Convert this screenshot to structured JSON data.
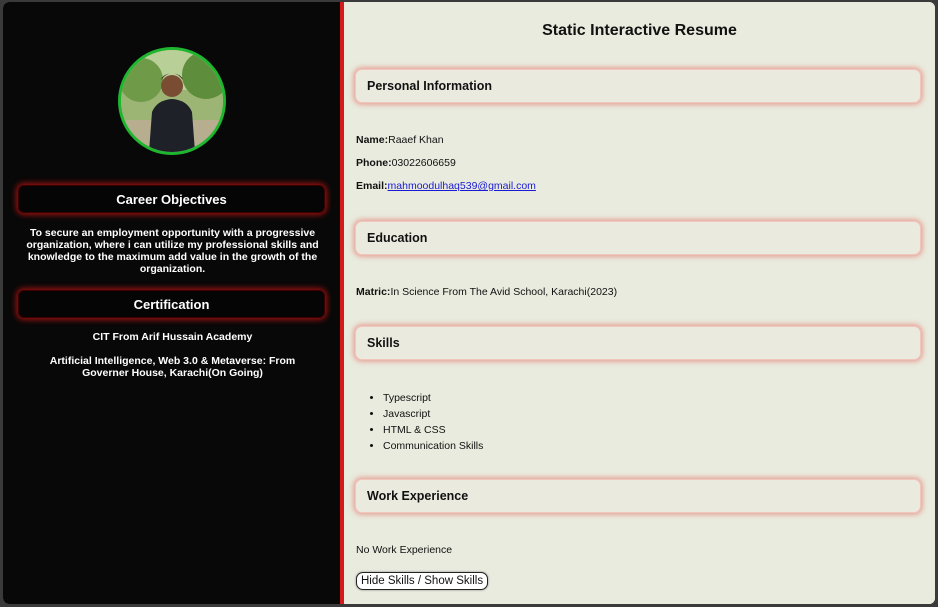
{
  "sidebar": {
    "career_heading": "Career Objectives",
    "career_text": "To secure an employment opportunity with a progressive organization, where i can utilize my professional skills and knowledge to the maximum add value in the growth of the organization.",
    "cert_heading": "Certification",
    "certs": [
      "CIT From Arif Hussain Academy",
      "Artificial Intelligence, Web 3.0 & Metaverse: From Governer House, Karachi(On Going)"
    ]
  },
  "main": {
    "title": "Static Interactive Resume",
    "personal": {
      "heading": "Personal Information",
      "name_label": "Name:",
      "name_value": "Raaef Khan",
      "phone_label": "Phone:",
      "phone_value": "03022606659",
      "email_label": "Email:",
      "email_value": "mahmoodulhaq539@gmail.com"
    },
    "education": {
      "heading": "Education",
      "label": "Matric:",
      "value": "In Science From The Avid School, Karachi(2023)"
    },
    "skills": {
      "heading": "Skills",
      "items": [
        "Typescript",
        "Javascript",
        "HTML & CSS",
        "Communication Skills"
      ]
    },
    "work": {
      "heading": "Work Experience",
      "text": "No Work Experience"
    },
    "toggle_label": "Hide Skills / Show Skills"
  },
  "colors": {
    "accent": "#d51a1a",
    "avatar_border": "#1fb62f",
    "sidebar_bg": "#080808",
    "main_bg": "#e9ebde"
  }
}
